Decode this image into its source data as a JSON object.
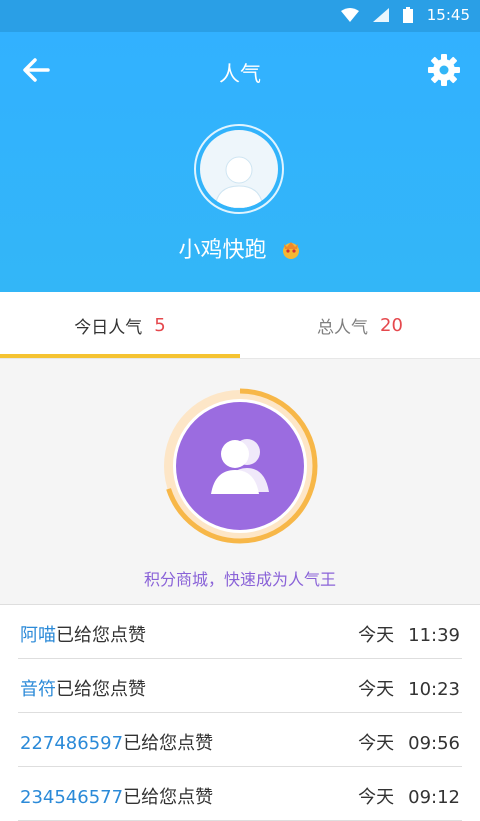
{
  "status_bar": {
    "time": "15:45"
  },
  "header": {
    "title": "人气",
    "username": "小鸡快跑"
  },
  "tabs": [
    {
      "label": "今日人气",
      "count": "5"
    },
    {
      "label": "总人气",
      "count": "20"
    }
  ],
  "promo_text": "积分商城，快速成为人气王",
  "likes": [
    {
      "name": "阿喵",
      "action": "已给您点赞",
      "day": "今天",
      "time": "11:39"
    },
    {
      "name": "音符",
      "action": "已给您点赞",
      "day": "今天",
      "time": "10:23"
    },
    {
      "name": "227486597",
      "action": "已给您点赞",
      "day": "今天",
      "time": "09:56"
    },
    {
      "name": "234546577",
      "action": "已给您点赞",
      "day": "今天",
      "time": "09:12"
    }
  ],
  "colors": {
    "header": "#33b6f7",
    "accent_tab": "#f5c331",
    "count": "#e5484d",
    "name_link": "#2b8ad8",
    "purple": "#9b6ce0"
  },
  "icons": [
    "wifi-icon",
    "signal-icon",
    "battery-icon",
    "back-arrow-icon",
    "gear-icon",
    "user-avatar-icon",
    "crown-badge-icon",
    "people-icon"
  ]
}
